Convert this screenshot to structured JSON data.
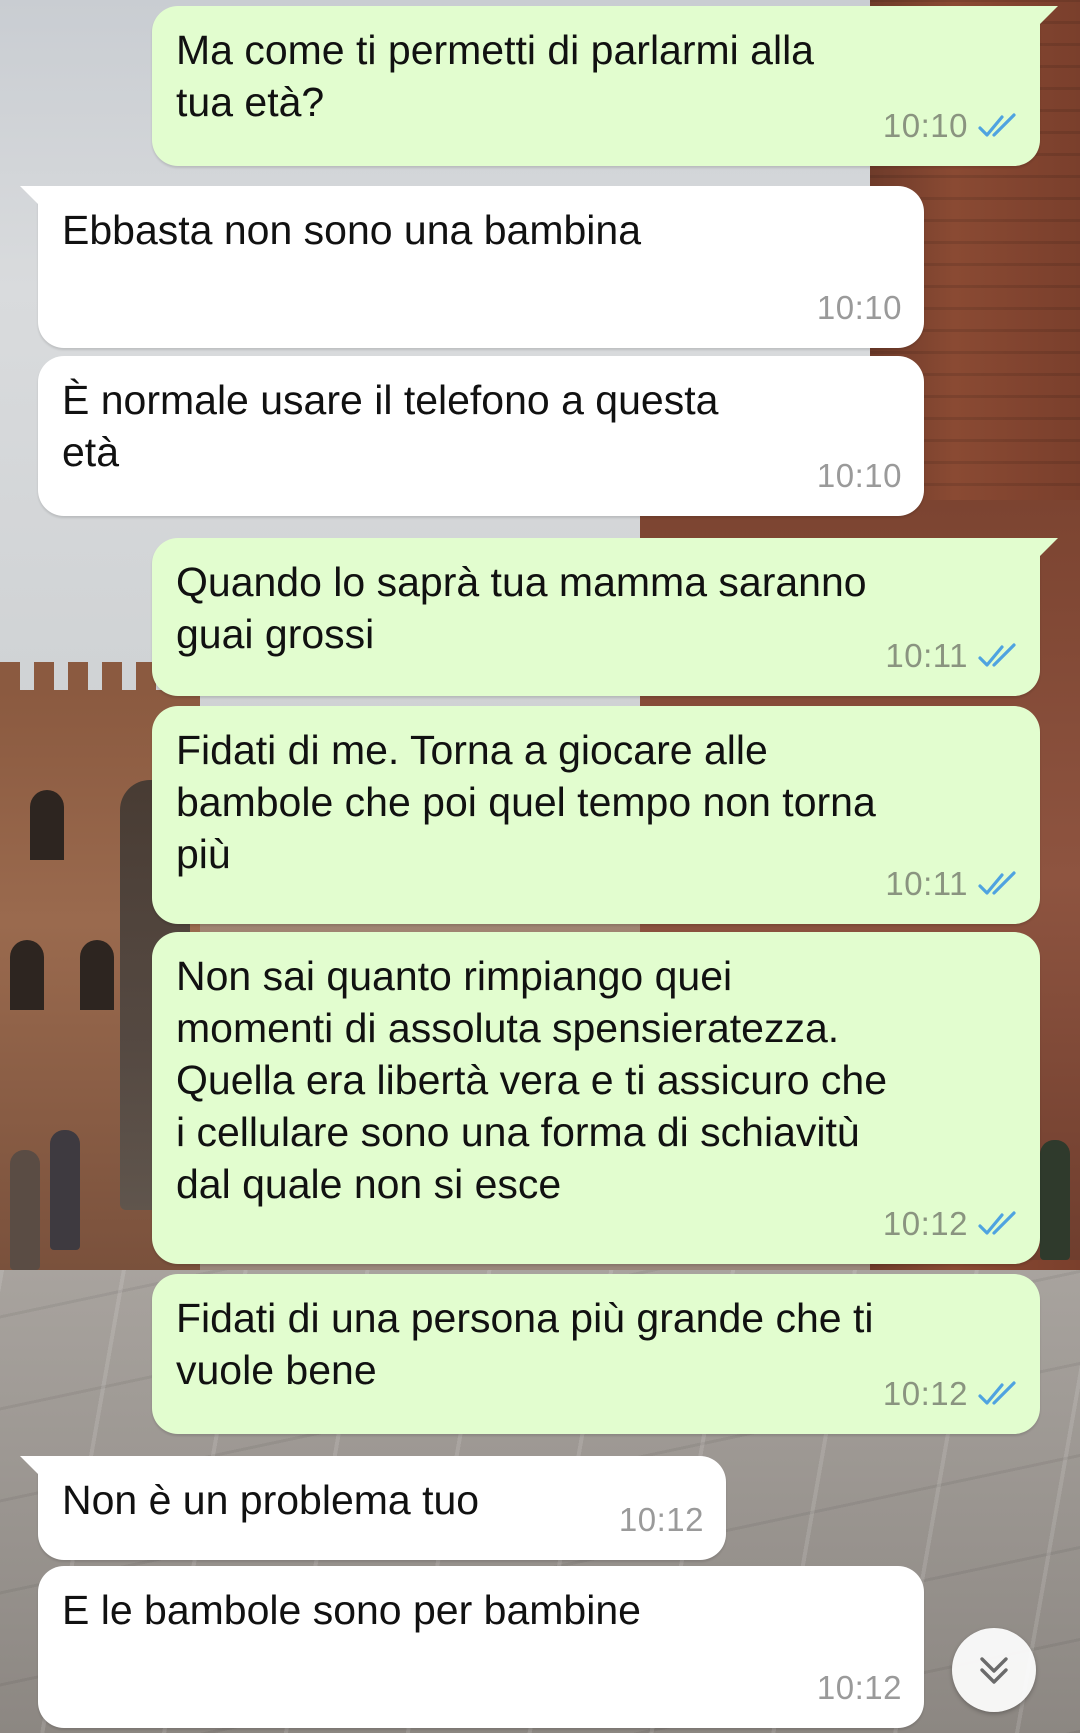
{
  "messages": [
    {
      "direction": "out",
      "text": "Ma come ti permetti di parlarmi alla\ntua età?",
      "time": "10:10",
      "status": "read"
    },
    {
      "direction": "in",
      "text": "Ebbasta non sono una bambina",
      "time": "10:10"
    },
    {
      "direction": "in",
      "text": "È normale usare il telefono a questa\netà",
      "time": "10:10"
    },
    {
      "direction": "out",
      "text": "Quando lo saprà tua mamma saranno\nguai grossi",
      "time": "10:11",
      "status": "read"
    },
    {
      "direction": "out",
      "text": "Fidati di me. Torna a giocare alle\nbambole che poi quel tempo non torna\npiù",
      "time": "10:11",
      "status": "read"
    },
    {
      "direction": "out",
      "text": "Non sai quanto rimpiango quei\nmomenti di assoluta spensieratezza.\nQuella era libertà vera e ti assicuro che\ni cellulare sono una forma di schiavitù\ndal quale non si esce",
      "time": "10:12",
      "status": "read"
    },
    {
      "direction": "out",
      "text": "Fidati di una persona più grande che ti\nvuole bene",
      "time": "10:12",
      "status": "read"
    },
    {
      "direction": "in",
      "text": "Non è un problema tuo",
      "time": "10:12"
    },
    {
      "direction": "in",
      "text": "E le bambole sono per bambine",
      "time": "10:12"
    }
  ],
  "colors": {
    "outgoing_bubble": "#e2fdcf",
    "incoming_bubble": "#ffffff",
    "read_ticks": "#4fa3e0"
  },
  "icons": {
    "read_ticks": "double-check-icon",
    "scroll_down": "double-chevron-down-icon"
  }
}
